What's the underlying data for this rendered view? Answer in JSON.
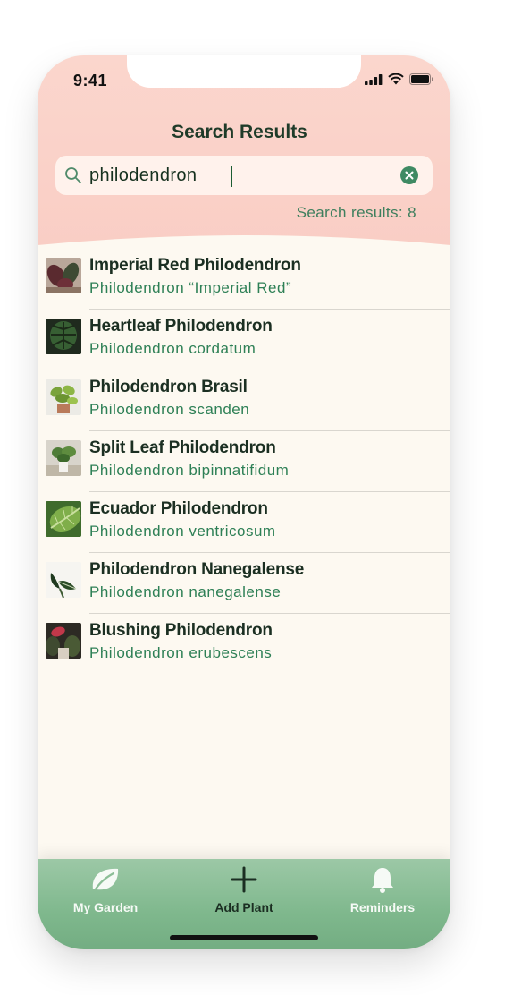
{
  "status_bar": {
    "time": "9:41"
  },
  "header": {
    "title": "Search Results",
    "search_value": "philodendron",
    "result_count": "Search results: 8"
  },
  "results": [
    {
      "common": "Imperial Red Philodendron",
      "scientific": "Philodendron “Imperial Red”"
    },
    {
      "common": "Heartleaf Philodendron",
      "scientific": "Philodendron cordatum"
    },
    {
      "common": "Philodendron Brasil",
      "scientific": "Philodendron scanden"
    },
    {
      "common": "Split Leaf Philodendron",
      "scientific": "Philodendron bipinnatifidum"
    },
    {
      "common": "Ecuador Philodendron",
      "scientific": "Philodendron ventricosum"
    },
    {
      "common": "Philodendron Nanegalense",
      "scientific": "Philodendron nanegalense"
    },
    {
      "common": "Blushing Philodendron",
      "scientific": "Philodendron erubescens"
    }
  ],
  "tabbar": {
    "my_garden": "My Garden",
    "add_plant": "Add Plant",
    "reminders": "Reminders"
  },
  "icons": {
    "my_garden": "leaf-icon",
    "add_plant": "plus-icon",
    "reminders": "bell-icon"
  },
  "colors": {
    "header_bg": "#f9cdc4",
    "accent_green": "#2e8056",
    "tabbar_bg": "#7fb88d",
    "list_bg": "#fdf9f1"
  }
}
